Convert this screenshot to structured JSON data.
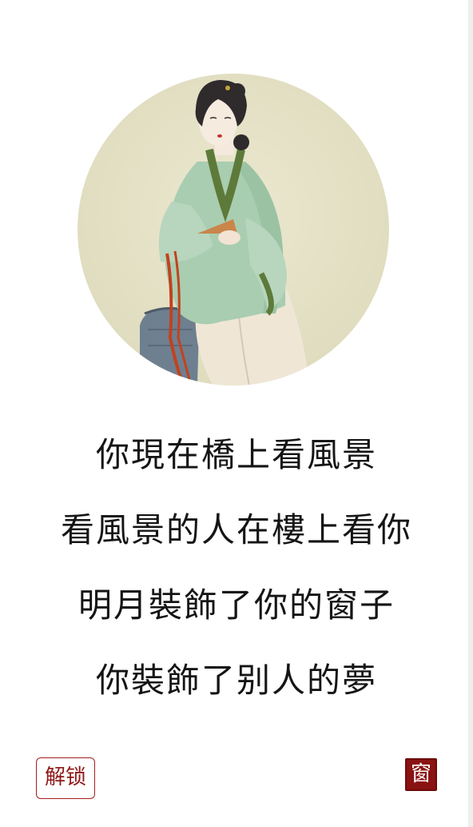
{
  "portrait": {
    "subject": "seated-lady-painting"
  },
  "poem": {
    "lines": [
      "你現在橋上看風景",
      "看風景的人在樓上看你",
      "明月裝飾了你的窗子",
      "你裝飾了别人的夢"
    ]
  },
  "footer": {
    "unlock_label": "解锁",
    "seal_label": "窗"
  },
  "colors": {
    "accent": "#8a1212",
    "text": "#151515",
    "background": "#ffffff",
    "portrait_bg": "#e6e3c9"
  }
}
